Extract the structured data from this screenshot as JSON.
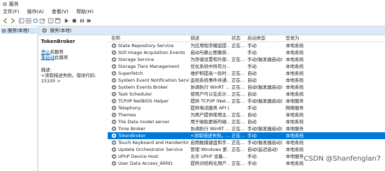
{
  "window": {
    "title": "服务"
  },
  "menu": [
    "文件(F)",
    "操作(A)",
    "查看(V)",
    "帮助(H)"
  ],
  "toolbar": {
    "icons": [
      "back-icon",
      "forward-icon",
      "console-tree-icon",
      "properties-icon",
      "refresh-icon",
      "export-icon",
      "help-icon",
      "console-icon",
      "play-icon",
      "stop-icon",
      "pause-icon",
      "restart-icon"
    ]
  },
  "tree": {
    "root": "服务(本地)"
  },
  "header": {
    "title": "服务(本地)"
  },
  "detail": {
    "name": "TokenBroker",
    "stop_link": "停止",
    "stop_suffix": "此服务",
    "restart_link": "重启动",
    "restart_suffix": "此服务",
    "desc_label": "描述:",
    "desc_text": "<读取描述失败。错误代码: 15100 >"
  },
  "table": {
    "columns": [
      "名称",
      "描述",
      "状态",
      "启动类型",
      "登录为"
    ],
    "rows": [
      {
        "name": "State Repository Service",
        "desc": "为应用程序模型提...",
        "status": "正在...",
        "startup": "手动",
        "logon": "本地系统"
      },
      {
        "name": "Still Image Acquisition Events",
        "desc": "启动与静止图像获...",
        "status": "",
        "startup": "手动",
        "logon": "本地系统"
      },
      {
        "name": "Storage Service",
        "desc": "为存储设置和外部...",
        "status": "正在...",
        "startup": "手动(触发器启动)",
        "logon": "本地系统"
      },
      {
        "name": "Storage Tiers Management",
        "desc": "优化系统中所有分...",
        "status": "",
        "startup": "手动",
        "logon": "本地系统"
      },
      {
        "name": "Superfetch",
        "desc": "维护和提高一段时...",
        "status": "正在...",
        "startup": "自动",
        "logon": "本地系统"
      },
      {
        "name": "System Event Notification Service",
        "desc": "监视系统事件并通...",
        "status": "正在...",
        "startup": "自动",
        "logon": "本地系统"
      },
      {
        "name": "System Events Broker",
        "desc": "协调执行 WinRT ...",
        "status": "正在...",
        "startup": "自动(触发器启动)",
        "logon": "本地系统"
      },
      {
        "name": "Task Scheduler",
        "desc": "使用户可以在此计...",
        "status": "正在...",
        "startup": "自动",
        "logon": "本地系统"
      },
      {
        "name": "TCP/IP NetBIOS Helper",
        "desc": "提供 TCP/IP (Net...",
        "status": "正在...",
        "startup": "手动(触发器启动)",
        "logon": "本地服务"
      },
      {
        "name": "Telephony",
        "desc": "提供电话服务 API (...",
        "status": "",
        "startup": "手动",
        "logon": "网络服务"
      },
      {
        "name": "Themes",
        "desc": "为用户提供使用主...",
        "status": "正在...",
        "startup": "自动",
        "logon": "本地系统"
      },
      {
        "name": "Tile Data model server",
        "desc": "用于磁贴更新的磁...",
        "status": "正在...",
        "startup": "自动",
        "logon": "本地系统"
      },
      {
        "name": "Time Broker",
        "desc": "协调执行 WinRT ...",
        "status": "正在...",
        "startup": "手动(触发器启动)",
        "logon": "本地服务"
      },
      {
        "name": "TokenBroker",
        "desc": "<读取描述失败。...",
        "status": "正在...",
        "startup": "手动",
        "logon": "本地系统"
      },
      {
        "name": "Touch Keyboard and Handwriting ...",
        "desc": "启用触摸键盘和手...",
        "status": "正在...",
        "startup": "手动(触发器启动)",
        "logon": "本地系统"
      },
      {
        "name": "Update Orchestrator Service",
        "desc": "管理 Windows 更...",
        "status": "正在...",
        "startup": "自动(延迟启动)",
        "logon": "本地系统"
      },
      {
        "name": "UPnP Device Host",
        "desc": "允许 UPnP 设备...",
        "status": "",
        "startup": "手动",
        "logon": "本地服务"
      },
      {
        "name": "User Data Access_66fd1",
        "desc": "提供对结构化用户...",
        "status": "正在...",
        "startup": "手动",
        "logon": "本地系统"
      }
    ],
    "selected_index": 13
  },
  "watermark": "CSDN @Shanfenglan7",
  "colors": {
    "selection": "#0078d7",
    "header_bg": "#dce9f6",
    "tree_selected": "#cfe3f7",
    "link": "#0b5fb0"
  }
}
